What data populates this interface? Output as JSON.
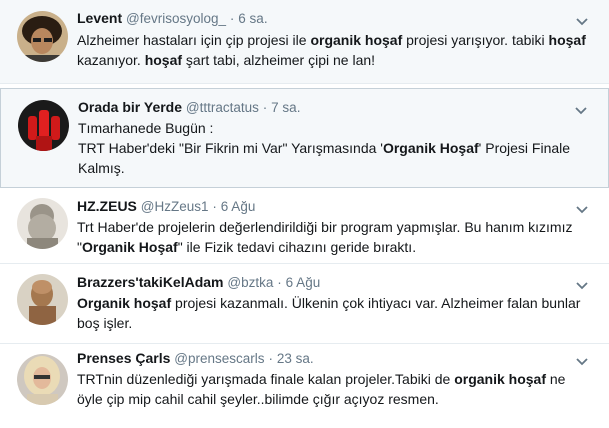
{
  "tweets": [
    {
      "name": "Levent",
      "handle": "@fevrisosyolog_",
      "sep": "·",
      "time": "6 sa.",
      "avatar_icon": "avatar-dark-hair",
      "text_parts": [
        {
          "t": "Alzheimer hastaları için çip projesi ile ",
          "b": false
        },
        {
          "t": "organik hoşaf",
          "b": true
        },
        {
          "t": " projesi yarışıyor. tabiki ",
          "b": false
        },
        {
          "t": "hoşaf",
          "b": true
        },
        {
          "t": " kazanıyor. ",
          "b": false
        },
        {
          "t": "hoşaf",
          "b": true
        },
        {
          "t": " şart tabi, alzheimer çipi ne lan!",
          "b": false
        }
      ]
    },
    {
      "name": "Orada bir Yerde",
      "handle": "@tttractatus",
      "sep": "·",
      "time": "7 sa.",
      "avatar_icon": "avatar-red-fist",
      "text_parts": [
        {
          "t": "Tımarhanede Bugün :",
          "b": false
        },
        {
          "t": "\n",
          "b": false
        },
        {
          "t": "TRT Haber'deki \"Bir Fikrin mi Var\" Yarışmasında '",
          "b": false
        },
        {
          "t": "Organik Hoşaf",
          "b": true
        },
        {
          "t": "' Projesi Finale Kalmış.",
          "b": false
        }
      ]
    },
    {
      "name": "HZ.ZEUS",
      "handle": "@HzZeus1",
      "sep": "·",
      "time": "6 Ağu",
      "avatar_icon": "avatar-zeus-statue",
      "text_parts": [
        {
          "t": "Trt Haber'de projelerin değerlendirildiği bir program yapmışlar. Bu hanım kızımız \"",
          "b": false
        },
        {
          "t": "Organik Hoşaf",
          "b": true
        },
        {
          "t": "\" ile Fizik tedavi cihazını geride bıraktı.",
          "b": false
        }
      ]
    },
    {
      "name": "Brazzers'takiKelAdam",
      "handle": "@bztka",
      "sep": "·",
      "time": "6 Ağu",
      "avatar_icon": "avatar-bald-man",
      "text_parts": [
        {
          "t": "Organik hoşaf",
          "b": true
        },
        {
          "t": " projesi kazanmalı. Ülkenin çok ihtiyacı var. Alzheimer falan bunlar boş işler.",
          "b": false
        }
      ]
    },
    {
      "name": "Prenses Çarls",
      "handle": "@prensescarls",
      "sep": "·",
      "time": "23 sa.",
      "avatar_icon": "avatar-blonde-woman",
      "text_parts": [
        {
          "t": "TRTnin düzenlediği yarışmada finale kalan projeler.Tabiki de ",
          "b": false
        },
        {
          "t": "organik hoşaf",
          "b": true
        },
        {
          "t": " ne öyle çip mip cahil cahil şeyler..bilimde çığır açıyoz resmen.",
          "b": false
        }
      ]
    }
  ],
  "icons": {
    "menu": "chevron-down-icon"
  },
  "colors": {
    "name": "#14171a",
    "meta": "#657786",
    "highlight_bg": "#f5f8fa"
  }
}
